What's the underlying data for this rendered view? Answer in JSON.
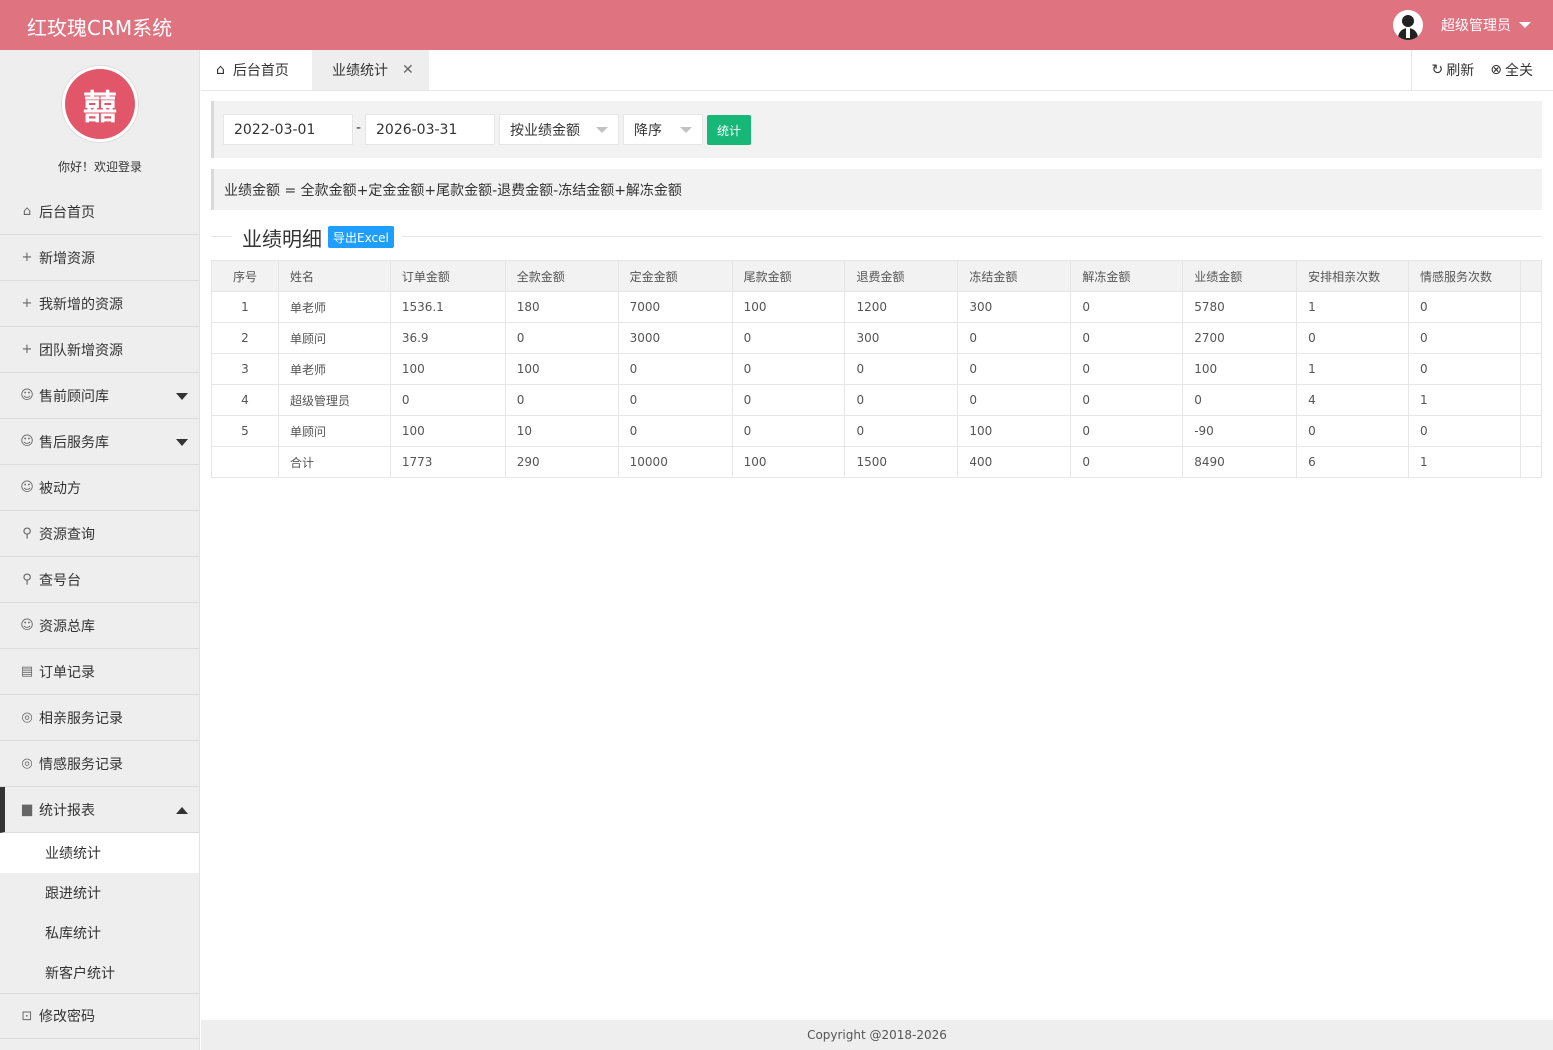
{
  "header": {
    "app_title": "红玫瑰CRM系统",
    "user_name": "超级管理员"
  },
  "sidebar": {
    "avatar_glyph": "囍",
    "welcome": "你好！欢迎登录",
    "items": [
      {
        "label": "后台首页",
        "icon": "home-icon"
      },
      {
        "label": "新增资源",
        "icon": "plus-icon"
      },
      {
        "label": "我新增的资源",
        "icon": "plus-icon"
      },
      {
        "label": "团队新增资源",
        "icon": "plus-icon"
      },
      {
        "label": "售前顾问库",
        "icon": "users-icon"
      },
      {
        "label": "售后服务库",
        "icon": "users-icon"
      },
      {
        "label": "被动方",
        "icon": "users-icon"
      },
      {
        "label": "资源查询",
        "icon": "search-icon"
      },
      {
        "label": "查号台",
        "icon": "search-icon"
      },
      {
        "label": "资源总库",
        "icon": "user-icon"
      },
      {
        "label": "订单记录",
        "icon": "clipboard-icon"
      },
      {
        "label": "相亲服务记录",
        "icon": "chat-icon"
      },
      {
        "label": "情感服务记录",
        "icon": "chat-icon"
      },
      {
        "label": "统计报表",
        "icon": "chart-icon"
      }
    ],
    "sub_items": [
      "业绩统计",
      "跟进统计",
      "私库统计",
      "新客户统计"
    ],
    "last_item": {
      "label": "修改密码",
      "icon": "lock-icon"
    }
  },
  "tabs": {
    "home": "后台首页",
    "current": "业绩统计",
    "refresh": "刷新",
    "close_all": "全关"
  },
  "filter": {
    "start_date": "2022-03-01",
    "separator": "-",
    "end_date": "2026-03-31",
    "sort_by": "按业绩金额",
    "order": "降序",
    "submit": "统计"
  },
  "note": "业绩金额 = 全款金额+定金金额+尾款金额-退费金额-冻结金额+解冻金额",
  "section": {
    "title": "业绩明细",
    "export": "导出Excel"
  },
  "table": {
    "headers": [
      "序号",
      "姓名",
      "订单金额",
      "全款金额",
      "定金金额",
      "尾款金额",
      "退费金额",
      "冻结金额",
      "解冻金额",
      "业绩金额",
      "安排相亲次数",
      "情感服务次数"
    ],
    "rows": [
      [
        "1",
        "单老师",
        "1536.1",
        "180",
        "7000",
        "100",
        "1200",
        "300",
        "0",
        "5780",
        "1",
        "0"
      ],
      [
        "2",
        "单顾问",
        "36.9",
        "0",
        "3000",
        "0",
        "300",
        "0",
        "0",
        "2700",
        "0",
        "0"
      ],
      [
        "3",
        "单老师",
        "100",
        "100",
        "0",
        "0",
        "0",
        "0",
        "0",
        "100",
        "1",
        "0"
      ],
      [
        "4",
        "超级管理员",
        "0",
        "0",
        "0",
        "0",
        "0",
        "0",
        "0",
        "0",
        "4",
        "1"
      ],
      [
        "5",
        "单顾问",
        "100",
        "10",
        "0",
        "0",
        "0",
        "100",
        "0",
        "-90",
        "0",
        "0"
      ],
      [
        "",
        "合计",
        "1773",
        "290",
        "10000",
        "100",
        "1500",
        "400",
        "0",
        "8490",
        "6",
        "1"
      ]
    ]
  },
  "footer": "Copyright @2018-2026"
}
